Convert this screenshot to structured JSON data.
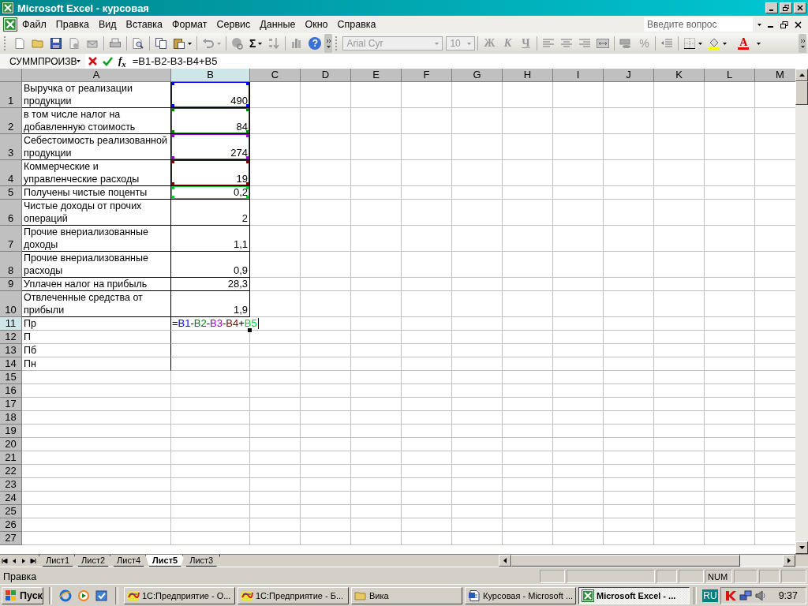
{
  "window": {
    "title": "Microsoft Excel - курсовая"
  },
  "menu": [
    "Файл",
    "Правка",
    "Вид",
    "Вставка",
    "Формат",
    "Сервис",
    "Данные",
    "Окно",
    "Справка"
  ],
  "help_box": {
    "placeholder": "Введите вопрос"
  },
  "toolbar": {
    "sum": "Σ",
    "help": "?",
    "font": "Arial Cyr",
    "size": "10",
    "bold": "Ж",
    "italic": "К",
    "underline": "Ч",
    "percent": "%",
    "font_color": "A"
  },
  "formula_bar": {
    "name_box": "СУММПРОИЗВ",
    "fx": "f$_{x}$",
    "formula": "=B1-B2-B3-B4+B5"
  },
  "columns": [
    {
      "label": "A",
      "selected": false
    },
    {
      "label": "B",
      "selected": true
    },
    {
      "label": "C",
      "selected": false
    },
    {
      "label": "D",
      "selected": false
    },
    {
      "label": "E",
      "selected": false
    },
    {
      "label": "F",
      "selected": false
    },
    {
      "label": "G",
      "selected": false
    },
    {
      "label": "H",
      "selected": false
    },
    {
      "label": "I",
      "selected": false
    },
    {
      "label": "J",
      "selected": false
    },
    {
      "label": "K",
      "selected": false
    },
    {
      "label": "L",
      "selected": false
    },
    {
      "label": "M",
      "selected": false
    }
  ],
  "rows": [
    {
      "number": "1",
      "a": "Выручка от реализации продукции",
      "b": "490",
      "bordered": true,
      "selected": false,
      "color": "#0000ff"
    },
    {
      "number": "2",
      "a": "в том числе налог на добавленную стоимость",
      "b": "84",
      "bordered": true,
      "selected": false,
      "color": "#008000"
    },
    {
      "number": "3",
      "a": "Себестоимость реализованной продукции",
      "b": "274",
      "bordered": true,
      "selected": false,
      "color": "#9900cc"
    },
    {
      "number": "4",
      "a": "Коммерческие и управленческие расходы",
      "b": "19",
      "bordered": true,
      "selected": false,
      "color": "#800000"
    },
    {
      "number": "5",
      "a": "Получены чистые поценты",
      "b": "0,2",
      "bordered": true,
      "selected": false,
      "color": "#00cc33"
    },
    {
      "number": "6",
      "a": "Чистые доходы от прочих операций",
      "b": "2",
      "bordered": true,
      "selected": false
    },
    {
      "number": "7",
      "a": "Прочие внериализованные доходы",
      "b": "1,1",
      "bordered": true,
      "selected": false
    },
    {
      "number": "8",
      "a": "Прочие внериализованные расходы",
      "b": "0,9",
      "bordered": true,
      "selected": false
    },
    {
      "number": "9",
      "a": "Уплачен налог на прибыль",
      "b": "28,3",
      "bordered": true,
      "selected": false
    },
    {
      "number": "10",
      "a": "Отвлеченные средства от прибыли",
      "b": "1,9",
      "bordered": true,
      "selected": false
    },
    {
      "number": "11",
      "a": "Пр",
      "bordered": false,
      "selected": true,
      "editing": true
    },
    {
      "number": "12",
      "a": "П",
      "bordered": false,
      "selected": false
    },
    {
      "number": "13",
      "a": "Пб",
      "bordered": false,
      "selected": false
    },
    {
      "number": "14",
      "a": "Пн",
      "bordered": false,
      "selected": false
    },
    {
      "number": "15",
      "selected": false
    },
    {
      "number": "16",
      "selected": false
    },
    {
      "number": "17",
      "selected": false
    },
    {
      "number": "18",
      "selected": false
    },
    {
      "number": "19",
      "selected": false
    },
    {
      "number": "20",
      "selected": false
    },
    {
      "number": "21",
      "selected": false
    },
    {
      "number": "22",
      "selected": false
    },
    {
      "number": "23",
      "selected": false
    },
    {
      "number": "24",
      "selected": false
    },
    {
      "number": "25",
      "selected": false
    },
    {
      "number": "26",
      "selected": false
    },
    {
      "number": "27",
      "selected": false
    }
  ],
  "cell_editor": {
    "parts": [
      {
        "text": "="
      },
      {
        "text": "B1",
        "color": "#0000ff"
      },
      {
        "text": "-"
      },
      {
        "text": "B2",
        "color": "#008000"
      },
      {
        "text": "-"
      },
      {
        "text": "B3",
        "color": "#9900cc"
      },
      {
        "text": "-"
      },
      {
        "text": "B4",
        "color": "#800000"
      },
      {
        "text": "+"
      },
      {
        "text": "B5",
        "color": "#00cc33"
      }
    ]
  },
  "sheet_tabs": [
    {
      "label": "Лист1",
      "selected": false
    },
    {
      "label": "Лист2",
      "selected": false
    },
    {
      "label": "Лист4",
      "selected": false
    },
    {
      "label": "Лист5",
      "selected": true
    },
    {
      "label": "Лист3",
      "selected": false
    }
  ],
  "status_bar": {
    "text": "Правка",
    "indicator": "NUM"
  },
  "taskbar": {
    "start": "Пуск",
    "tasks": [
      {
        "label": "1С:Предприятие - О...",
        "kind": "app",
        "selected": false
      },
      {
        "label": "1С:Предприятие - Б...",
        "kind": "app",
        "selected": false
      },
      {
        "label": "Вика",
        "kind": "folder",
        "selected": false
      },
      {
        "label": "Курсовая - Microsoft ...",
        "kind": "document",
        "selected": false
      },
      {
        "label": "Microsoft Excel - ...",
        "kind": "spreadsheet",
        "selected": true
      }
    ],
    "language": "RU",
    "clock": "9:37"
  }
}
